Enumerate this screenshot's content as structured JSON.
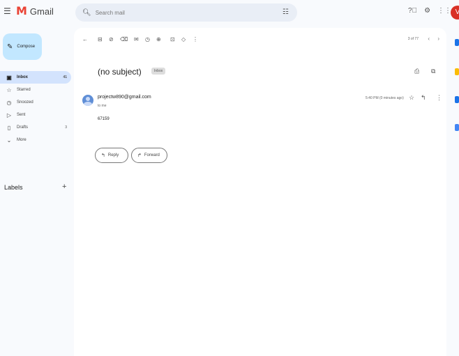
{
  "header": {
    "logo_mark": "M",
    "logo_text": "Gmail",
    "search_placeholder": "Search mail",
    "avatar_initial": "V"
  },
  "sidebar": {
    "compose_label": "Compose",
    "items": [
      {
        "label": "Inbox",
        "count": "41",
        "icon": "inbox-icon"
      },
      {
        "label": "Starred",
        "count": "",
        "icon": "star-icon"
      },
      {
        "label": "Snoozed",
        "count": "",
        "icon": "clock-icon"
      },
      {
        "label": "Sent",
        "count": "",
        "icon": "send-icon"
      },
      {
        "label": "Drafts",
        "count": "3",
        "icon": "draft-icon"
      },
      {
        "label": "More",
        "count": "",
        "icon": "chevron-down-icon"
      }
    ],
    "labels_title": "Labels"
  },
  "toolbar": {
    "pager_text": "3 of 77"
  },
  "message": {
    "subject": "(no subject)",
    "folder_chip": "Inbox",
    "sender": "projectw890@gmail.com",
    "to": "to me",
    "time": "5:40 PM (0 minutes ago)",
    "body": "67159",
    "reply_label": "Reply",
    "forward_label": "Forward"
  },
  "colors": {
    "accent": "#c2e7ff",
    "active_nav": "#d3e3fd",
    "avatar": "#d93025",
    "gmail_red": "#ea4335"
  }
}
